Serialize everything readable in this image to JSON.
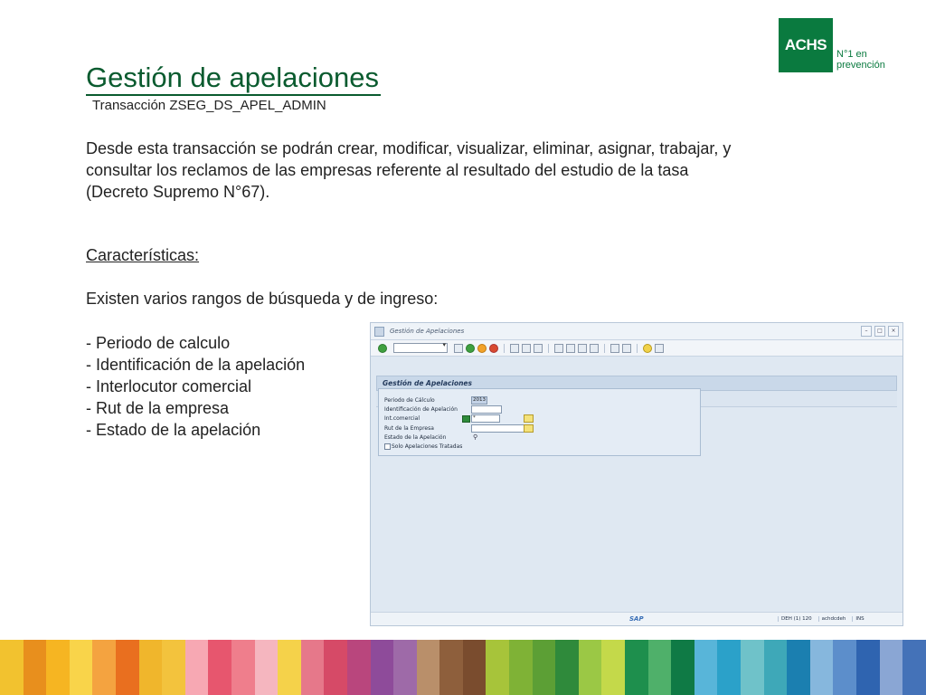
{
  "logo": {
    "brand": "ACHS",
    "tagline_1": "N°1 en",
    "tagline_2": "prevención"
  },
  "slide": {
    "title": "Gestión de apelaciones",
    "subtitle": "Transacción ZSEG_DS_APEL_ADMIN",
    "description": "Desde esta transacción se  podrán  crear, modificar, visualizar, eliminar, asignar, trabajar, y consultar los reclamos de las empresas referente al  resultado del estudio de la tasa (Decreto Supremo N°67).",
    "features_heading": "Características:",
    "ranges_intro": "Existen varios rangos de búsqueda y de ingreso:",
    "bullets": [
      "- Periodo de calculo",
      "- Identificación de la apelación",
      "- Interlocutor comercial",
      "- Rut de la empresa",
      "- Estado de la apelación"
    ]
  },
  "sap": {
    "window_title": "Gestión de Apelaciones",
    "header": "Gestión de Apelaciones",
    "form": {
      "periodo_label": "Periodo de Cálculo",
      "periodo_value": "2013",
      "identificacion_label": "Identificación de Apelación",
      "interlocutor_label": "Int.comercial",
      "interlocutor_value": "*",
      "rut_label": "Rut de la Empresa",
      "estado_label": "Estado de la Apelación",
      "checkbox_label": "Solo Apelaciones Tratadas"
    },
    "status": {
      "sap_logo": "SAP",
      "system": "DEH (1) 120",
      "user": "achdcdeh",
      "mode": "INS"
    }
  },
  "colors": {
    "brand_green": "#0a7a3f",
    "stripes": [
      "#f2c22f",
      "#e88f1d",
      "#f6b522",
      "#f9d44a",
      "#f4a340",
      "#e96f1f",
      "#f0b62c",
      "#f3c33d",
      "#f7a8b3",
      "#e7566e",
      "#ef7e8c",
      "#f5b6bf",
      "#f5d24a",
      "#e6788a",
      "#d64a67",
      "#b9467d",
      "#8e4b9a",
      "#9e6aa8",
      "#b98f6a",
      "#8e5f3c",
      "#7a4c2e",
      "#a7c43a",
      "#7fb236",
      "#5c9f35",
      "#2f8a3b",
      "#9bc845",
      "#c4d94a",
      "#1e8f4d",
      "#4fb06a",
      "#0f7a45",
      "#58b5d9",
      "#2ba1c9",
      "#6fc2c9",
      "#3ea8b8",
      "#1b7fb0",
      "#86b7dd",
      "#5c8ecb",
      "#2f64b0",
      "#8aa6d4",
      "#4472b8"
    ]
  }
}
